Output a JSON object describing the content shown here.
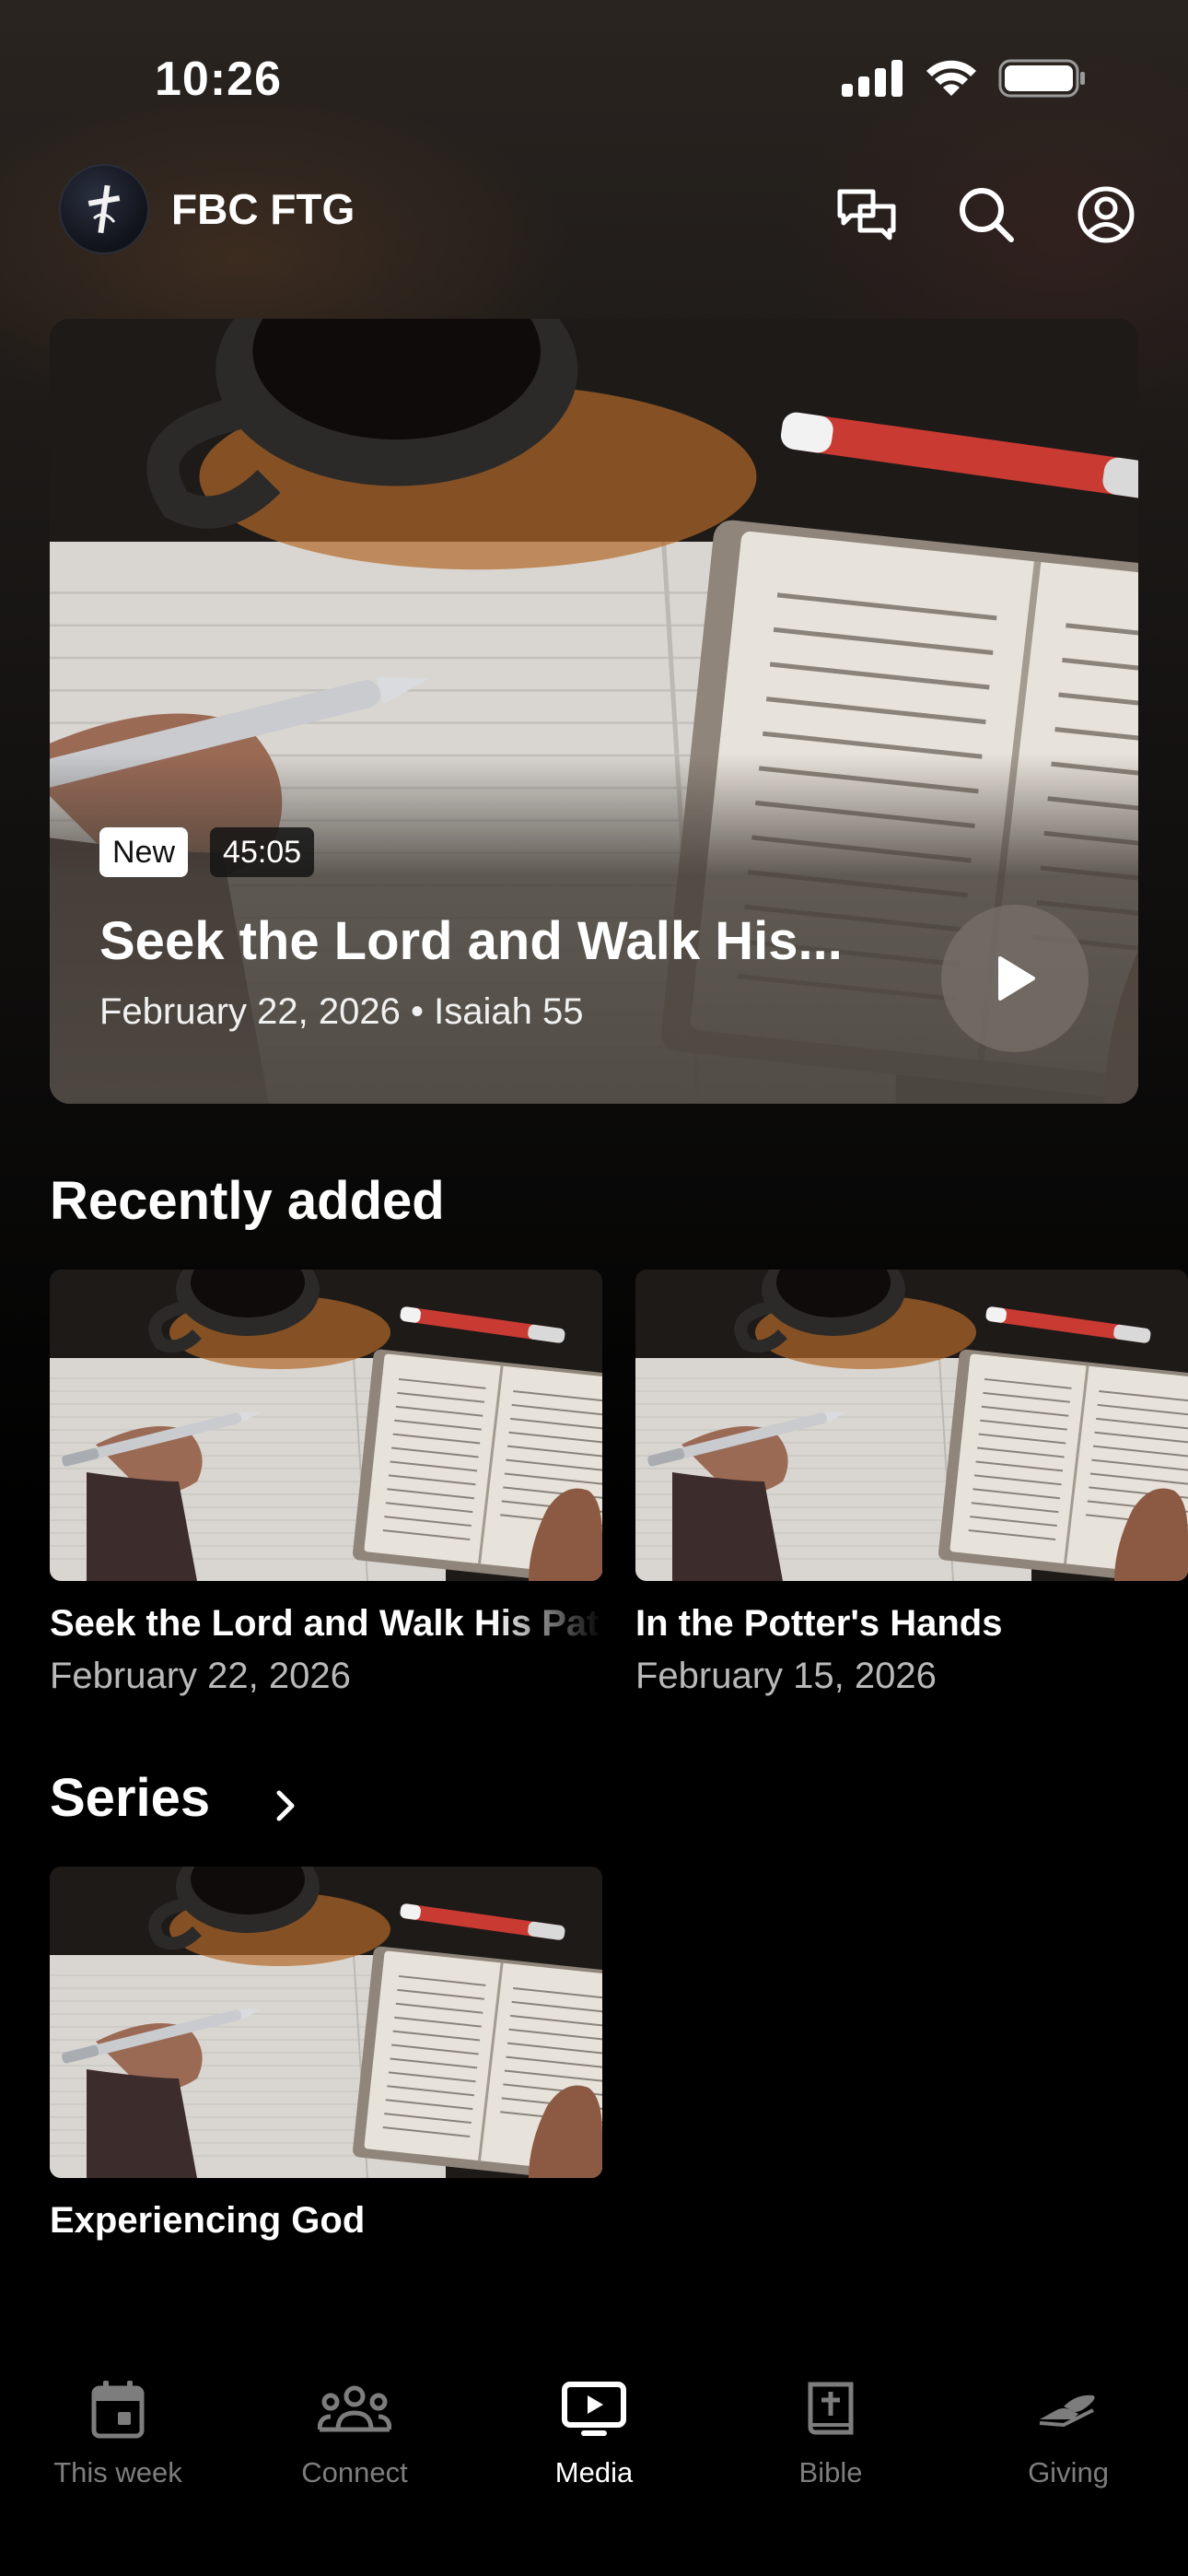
{
  "status_bar": {
    "time": "10:26"
  },
  "header": {
    "app_title": "FBC FTG",
    "icons": [
      "chat-bubbles-icon",
      "search-icon",
      "account-icon"
    ]
  },
  "hero": {
    "badge_new": "New",
    "duration": "45:05",
    "title": "Seek the Lord and Walk His...",
    "subtitle": "February 22, 2026 • Isaiah 55"
  },
  "recently_added": {
    "title": "Recently added",
    "items": [
      {
        "title": "Seek the Lord and Walk His Paths",
        "date": "February 22, 2026"
      },
      {
        "title": "In the Potter's Hands",
        "date": "February 15, 2026"
      }
    ]
  },
  "series": {
    "title": "Series",
    "items": [
      {
        "title": "Experiencing God"
      }
    ]
  },
  "tab_bar": {
    "tabs": [
      {
        "label": "This week",
        "icon": "calendar-icon",
        "active": false
      },
      {
        "label": "Connect",
        "icon": "people-icon",
        "active": false
      },
      {
        "label": "Media",
        "icon": "tv-play-icon",
        "active": true
      },
      {
        "label": "Bible",
        "icon": "bible-icon",
        "active": false
      },
      {
        "label": "Giving",
        "icon": "giving-hand-icon",
        "active": false
      }
    ]
  },
  "colors": {
    "background": "#000000",
    "active_tab": "#ffffff",
    "inactive_tab": "#7d7d7d",
    "secondary_text": "#b9b9b9"
  }
}
